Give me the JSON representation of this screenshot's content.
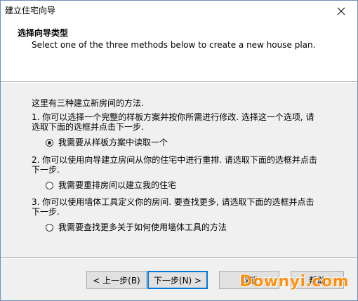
{
  "window": {
    "title": "建立住宅向导"
  },
  "header": {
    "title": "选择向导类型",
    "subtitle": "Select one of the three methods below to create a new house plan."
  },
  "body": {
    "intro": "这里有三种建立新房间的方法.",
    "options": [
      {
        "description_line1": "1. 你可以选择一个完整的样板方案并按你所需进行修改. 选择这一个选项, 请",
        "description_line2": "选取下面的选框并点击下一步.",
        "radio_label": "我需要从样板方案中读取一个",
        "checked": true
      },
      {
        "description_line1": "2. 你可以使用向导建立房间从你的住宅中进行重排. 请选取下面的选框并点击",
        "description_line2": "下一步.",
        "radio_label": "我需要重排房间以建立我的住宅",
        "checked": false
      },
      {
        "description_line1": "3. 你可以使用墙体工具定义你的房间. 要查找更多, 请选取下面的选框并点击",
        "description_line2": "下一步.",
        "radio_label": "我需要查找更多关于如何使用墙体工具的方法",
        "checked": false
      }
    ]
  },
  "buttons": {
    "back": "< 上一步(B)",
    "next": "下一步(N) >",
    "cancel": "取消",
    "help": "帮助"
  },
  "watermark": "Downyi.com",
  "icons": {
    "close": "close-icon"
  }
}
